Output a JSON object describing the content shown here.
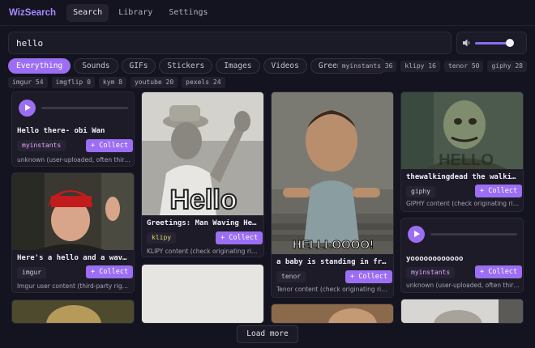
{
  "header": {
    "brand": "WizSearch",
    "tabs": [
      "Search",
      "Library",
      "Settings"
    ]
  },
  "search": {
    "value": "hello"
  },
  "volume": {
    "level": 0.85
  },
  "filters": [
    "Everything",
    "Sounds",
    "GIFs",
    "Stickers",
    "Images",
    "Videos",
    "Green screens"
  ],
  "source_counts": [
    "myinstants 36",
    "klipy 16",
    "tenor 50",
    "giphy 28",
    "imgur 54",
    "imgflip 0",
    "kym 8",
    "youtube 20",
    "pexels 24"
  ],
  "collect_label": "+ Collect",
  "cards": [
    {
      "title": "Hello there- obi Wan",
      "tag": "myinstants",
      "note": "unknown (user-uploaded, often third-party...",
      "progress": 0
    },
    {
      "title": "Here's a hello and a wave from m...",
      "tag": "imgur",
      "note": "Imgur user content (third-party rights)"
    },
    {
      "title": "Greetings: Man Waving Hello",
      "tag": "klipy",
      "note": "KLIPY content (check originating rights)",
      "overlay": "Hello"
    },
    {
      "title": "a baby is standing in front of a do...",
      "tag": "tenor",
      "note": "Tenor content (check originating rights)",
      "overlay": "HELLLOOOO!"
    },
    {
      "title": "thewalkingdead the walking dea...",
      "tag": "giphy",
      "note": "GIPHY content (check originating rights)",
      "overlay": "HELLO"
    },
    {
      "title": "yoooooooooooo",
      "tag": "myinstants",
      "note": "unknown (user-uploaded, often third-par...",
      "progress": 0
    }
  ],
  "load_more": "Load more",
  "colors": {
    "accent": "#9b6ef3",
    "background": "#141320",
    "card": "#1c1b27"
  }
}
